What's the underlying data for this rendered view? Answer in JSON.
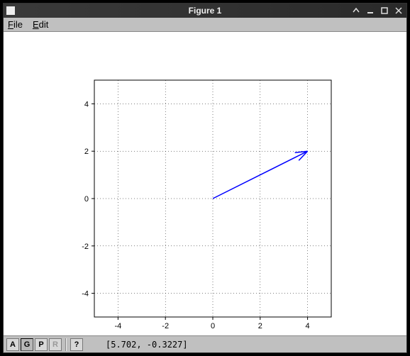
{
  "window": {
    "title": "Figure 1"
  },
  "menu": {
    "file": "File",
    "edit": "Edit"
  },
  "toolbar": {
    "a": "A",
    "g": "G",
    "p": "P",
    "r": "R",
    "help": "?"
  },
  "status": {
    "cursor_coords": "[5.702, -0.3227]"
  },
  "chart_data": {
    "type": "vector",
    "title": "",
    "xlabel": "",
    "ylabel": "",
    "xlim": [
      -5,
      5
    ],
    "ylim": [
      -5,
      5
    ],
    "xticks": [
      -4,
      -2,
      0,
      2,
      4
    ],
    "yticks": [
      -4,
      -2,
      0,
      2,
      4
    ],
    "grid": true,
    "grid_style": "dotted",
    "arrows": [
      {
        "x0": 0,
        "y0": 0,
        "x1": 4,
        "y1": 2,
        "color": "#0000ff"
      }
    ]
  }
}
